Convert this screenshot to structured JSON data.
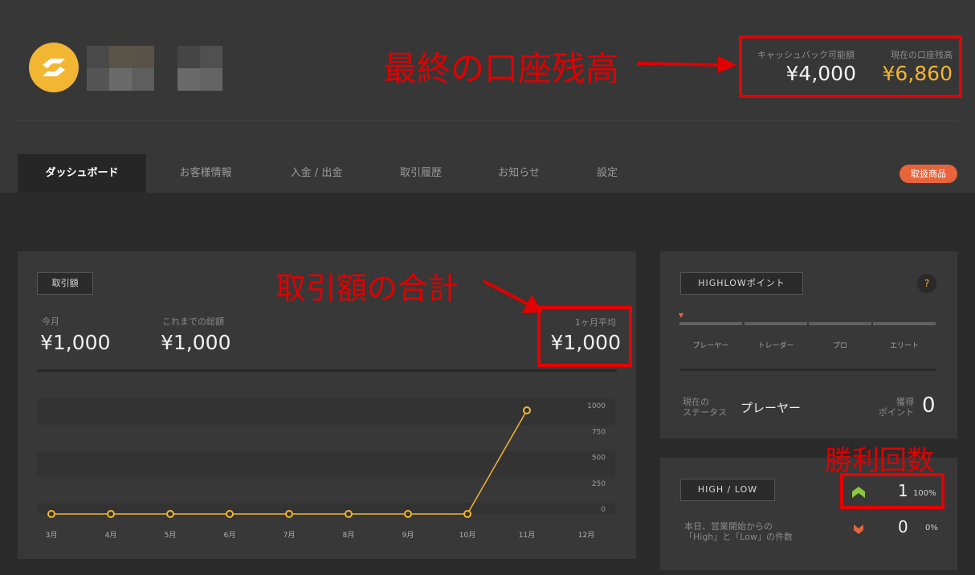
{
  "header": {
    "cashback_label": "キャッシュバック可能額",
    "cashback_value": "¥4,000",
    "balance_label": "現在の口座残高",
    "balance_value": "¥6,860"
  },
  "tabs": [
    {
      "label": "ダッシュボード",
      "active": true
    },
    {
      "label": "お客様情報"
    },
    {
      "label": "入金 / 出金"
    },
    {
      "label": "取引履歴"
    },
    {
      "label": "お知らせ"
    },
    {
      "label": "設定"
    }
  ],
  "products_button": "取扱商品",
  "annotations": {
    "balance": "最終の口座残高",
    "trade_total": "取引額の合計",
    "wins": "勝利回数"
  },
  "trade_panel": {
    "tag": "取引額",
    "this_month_label": "今月",
    "this_month_value": "¥1,000",
    "total_label": "これまでの総額",
    "total_value": "¥1,000",
    "avg_label": "1ヶ月平均",
    "avg_value": "¥1,000"
  },
  "chart_data": {
    "type": "line",
    "categories": [
      "3月",
      "4月",
      "5月",
      "6月",
      "7月",
      "8月",
      "9月",
      "10月",
      "11月",
      "12月"
    ],
    "series": [
      {
        "values": [
          0,
          0,
          0,
          0,
          0,
          0,
          0,
          0,
          1000,
          null
        ]
      }
    ],
    "ylim": [
      0,
      1000
    ],
    "yticks": [
      0,
      250,
      500,
      750,
      1000
    ],
    "grid": true,
    "color": "#f2b632"
  },
  "highlow_points": {
    "tag": "HIGHLOWポイント",
    "help": "?",
    "levels": [
      "プレーヤー",
      "トレーダー",
      "プロ",
      "エリート"
    ],
    "status_label_1": "現在の",
    "status_label_2": "ステータス",
    "status_value": "プレーヤー",
    "points_label_1": "獲得",
    "points_label_2": "ポイント",
    "points_value": "0"
  },
  "highlow_panel": {
    "tag": "HIGH / LOW",
    "desc_1": "本日、営業開始からの",
    "desc_2": "「High」と「Low」の件数",
    "high_count": "1",
    "high_pct": "100%",
    "low_count": "0",
    "low_pct": "0%",
    "high_color": "#8dc63f",
    "low_color": "#e8643a"
  }
}
